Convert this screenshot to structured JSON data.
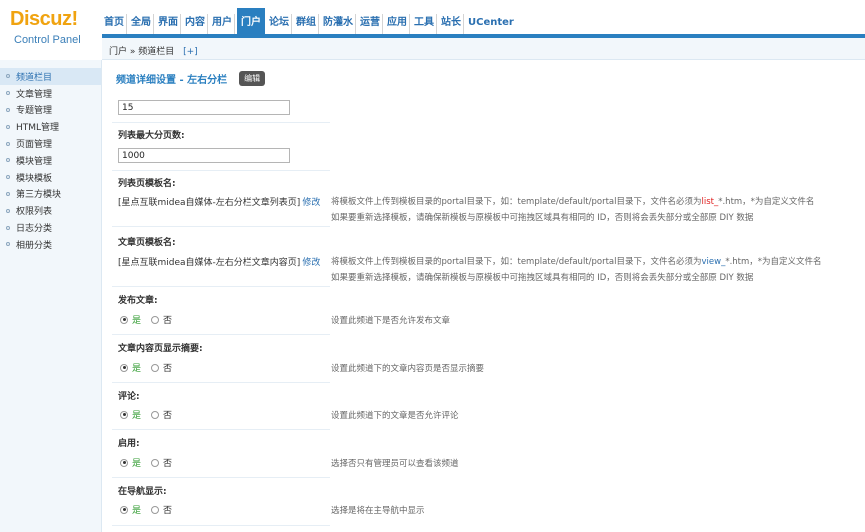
{
  "header": {
    "logo_text": "Discuz!",
    "logo_sub": "Control Panel",
    "nav": [
      "首页",
      "全局",
      "界面",
      "内容",
      "用户",
      "门户",
      "论坛",
      "群组",
      "防灌水",
      "运营",
      "应用",
      "工具",
      "站长",
      "UCenter"
    ],
    "active_nav": "门户"
  },
  "breadcrumb": {
    "text": "门户 » 频道栏目",
    "plus": "[+]"
  },
  "sidebar": {
    "items": [
      "频道栏目",
      "文章管理",
      "专题管理",
      "HTML管理",
      "页面管理",
      "模块管理",
      "模块模板",
      "第三方模块",
      "权限列表",
      "日志分类",
      "相册分类"
    ],
    "active": "频道栏目"
  },
  "main": {
    "title": "频道详细设置 - 左右分栏",
    "edit_badge": "编辑",
    "first_value": "15",
    "max_pages_label": "列表最大分页数:",
    "max_pages_value": "1000",
    "list_tpl_label": "列表页模板名:",
    "list_tpl_value": "[星点互联midea自媒体-左右分栏文章列表页]",
    "list_tpl_modify": "修改",
    "list_tpl_desc1_a": "将模板文件上传到模板目录的portal目录下，如：template/default/portal目录下，文件名必须为",
    "list_tpl_desc1_key": "list_",
    "list_tpl_desc1_b": "*.htm，*为自定义文件名",
    "list_tpl_desc2": "如果要重新选择模板，请确保新模板与原模板中可拖拽区域具有相同的 ID，否则将会丢失部分或全部原 DIY 数据",
    "article_tpl_label": "文章页模板名:",
    "article_tpl_value": "[星点互联midea自媒体-左右分栏文章内容页]",
    "article_tpl_modify": "修改",
    "article_tpl_desc1_a": "将模板文件上传到模板目录的portal目录下，如：template/default/portal目录下，文件名必须为",
    "article_tpl_desc1_key": "view_",
    "article_tpl_desc1_b": "*.htm，*为自定义文件名",
    "article_tpl_desc2": "如果要重新选择模板，请确保新模板与原模板中可拖拽区域具有相同的 ID，否则将会丢失部分或全部原 DIY 数据",
    "yes": "是",
    "no": "否",
    "publish_label": "发布文章:",
    "publish_desc": "设置此频道下是否允许发布文章",
    "summary_label": "文章内容页显示摘要:",
    "summary_desc": "设置此频道下的文章内容页是否显示摘要",
    "comment_label": "评论:",
    "comment_desc": "设置此频道下的文章是否允许评论",
    "enable_label": "启用:",
    "enable_desc": "选择否只有管理员可以查看该频道",
    "navshow_label": "在导航显示:",
    "navshow_desc": "选择是将在主导航中显示"
  }
}
